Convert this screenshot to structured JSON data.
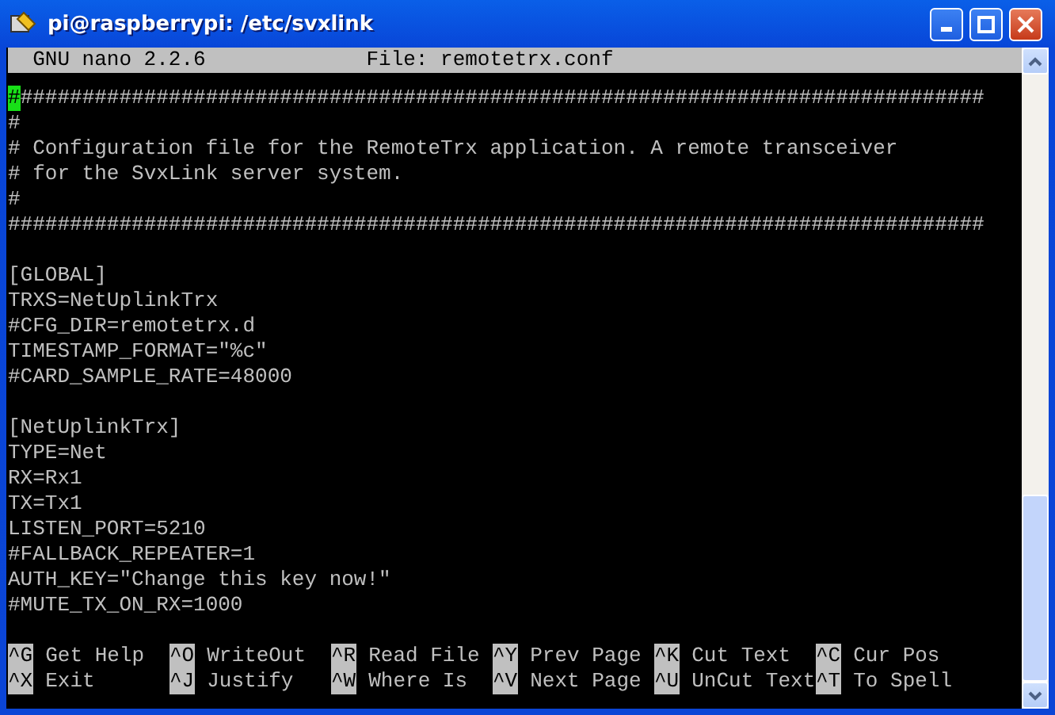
{
  "window": {
    "title": "pi@raspberrypi: /etc/svxlink"
  },
  "header": {
    "program": "GNU nano 2.2.6",
    "file": "File: remotetrx.conf"
  },
  "lines": [
    {
      "kind": "text",
      "cursor": "#",
      "text": "##############################################################################"
    },
    {
      "kind": "text",
      "text": "#"
    },
    {
      "kind": "text",
      "text": "# Configuration file for the RemoteTrx application. A remote transceiver"
    },
    {
      "kind": "text",
      "text": "# for the SvxLink server system."
    },
    {
      "kind": "text",
      "text": "#"
    },
    {
      "kind": "text",
      "text": "###############################################################################"
    },
    {
      "kind": "blank"
    },
    {
      "kind": "text",
      "text": "[GLOBAL]"
    },
    {
      "kind": "text",
      "text": "TRXS=NetUplinkTrx"
    },
    {
      "kind": "text",
      "text": "#CFG_DIR=remotetrx.d"
    },
    {
      "kind": "text",
      "text": "TIMESTAMP_FORMAT=\"%c\""
    },
    {
      "kind": "text",
      "text": "#CARD_SAMPLE_RATE=48000"
    },
    {
      "kind": "blank"
    },
    {
      "kind": "text",
      "text": "[NetUplinkTrx]"
    },
    {
      "kind": "text",
      "text": "TYPE=Net"
    },
    {
      "kind": "text",
      "text": "RX=Rx1"
    },
    {
      "kind": "text",
      "text": "TX=Tx1"
    },
    {
      "kind": "text",
      "text": "LISTEN_PORT=5210"
    },
    {
      "kind": "text",
      "text": "#FALLBACK_REPEATER=1"
    },
    {
      "kind": "text",
      "text": "AUTH_KEY=\"Change this key now!\""
    },
    {
      "kind": "text",
      "text": "#MUTE_TX_ON_RX=1000"
    }
  ],
  "shortcuts": [
    [
      {
        "key": "^G",
        "label": "Get Help"
      },
      {
        "key": "^O",
        "label": "WriteOut"
      },
      {
        "key": "^R",
        "label": "Read File"
      },
      {
        "key": "^Y",
        "label": "Prev Page"
      },
      {
        "key": "^K",
        "label": "Cut Text"
      },
      {
        "key": "^C",
        "label": "Cur Pos"
      }
    ],
    [
      {
        "key": "^X",
        "label": "Exit"
      },
      {
        "key": "^J",
        "label": "Justify"
      },
      {
        "key": "^W",
        "label": "Where Is"
      },
      {
        "key": "^V",
        "label": "Next Page"
      },
      {
        "key": "^U",
        "label": "UnCut Text"
      },
      {
        "key": "^T",
        "label": "To Spell"
      }
    ]
  ]
}
